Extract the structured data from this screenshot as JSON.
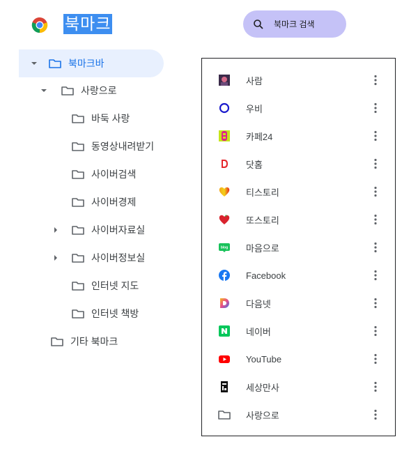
{
  "header": {
    "title": "북마크",
    "search_label": "북마크 검색"
  },
  "tree": {
    "root": "북마크바",
    "folder": "사랑으로",
    "children": [
      "바둑 사랑",
      "동영상내려받기",
      "사이버검색",
      "사이버경제",
      "사이버자료실",
      "사이버정보실",
      "인터넷 지도",
      "인터넷 책방"
    ],
    "other": "기타 북마크"
  },
  "bookmarks": [
    {
      "label": "사람",
      "icon": "photo-favicon"
    },
    {
      "label": "우비",
      "icon": "blue-ring-favicon"
    },
    {
      "label": "카페24",
      "icon": "cafe24-favicon"
    },
    {
      "label": "닷홈",
      "icon": "dothome-favicon"
    },
    {
      "label": "티스토리",
      "icon": "tistory-heart-favicon"
    },
    {
      "label": "또스토리",
      "icon": "ttostory-heart-favicon"
    },
    {
      "label": "마음으로",
      "icon": "blog-favicon"
    },
    {
      "label": "Facebook",
      "icon": "facebook-favicon"
    },
    {
      "label": "다음넷",
      "icon": "daum-favicon"
    },
    {
      "label": "네이버",
      "icon": "naver-favicon"
    },
    {
      "label": "YouTube",
      "icon": "youtube-favicon"
    },
    {
      "label": "세상만사",
      "icon": "black-block-favicon"
    },
    {
      "label": "사랑으로",
      "icon": "folder-icon"
    }
  ],
  "colors": {
    "accent": "#1a73e8",
    "title_highlight": "#3d8ef0",
    "search_pill": "#c5c2f7",
    "selected_row": "#e8f0fe"
  }
}
